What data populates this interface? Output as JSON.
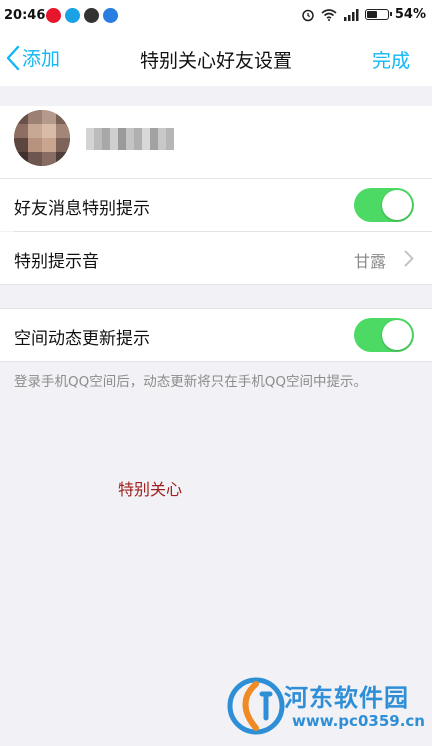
{
  "status_bar": {
    "time": "20:46",
    "battery_text": "54%",
    "battery_level": 0.54,
    "icons": [
      "weibo-icon",
      "qq-icon",
      "app-icon",
      "qq-browser-icon",
      "alarm-icon",
      "wifi-icon",
      "signal-icon",
      "battery-icon"
    ]
  },
  "nav": {
    "back_label": "添加",
    "title": "特别关心好友设置",
    "done_label": "完成",
    "accent": "#12b7f5"
  },
  "settings": {
    "rows": [
      {
        "label": "好友消息特别提示",
        "toggle": true
      },
      {
        "label": "特别提示音",
        "value": "甘露"
      },
      {
        "label": "空间动态更新提示",
        "toggle": true
      }
    ],
    "footnote": "登录手机QQ空间后，动态更新将只在手机QQ空间中提示。",
    "toggle_color": "#4cd964"
  },
  "annotation": {
    "text": "特别关心",
    "color": "#a0201b"
  },
  "watermark": {
    "title": "河东软件园",
    "url": "www.pc0359.cn"
  }
}
